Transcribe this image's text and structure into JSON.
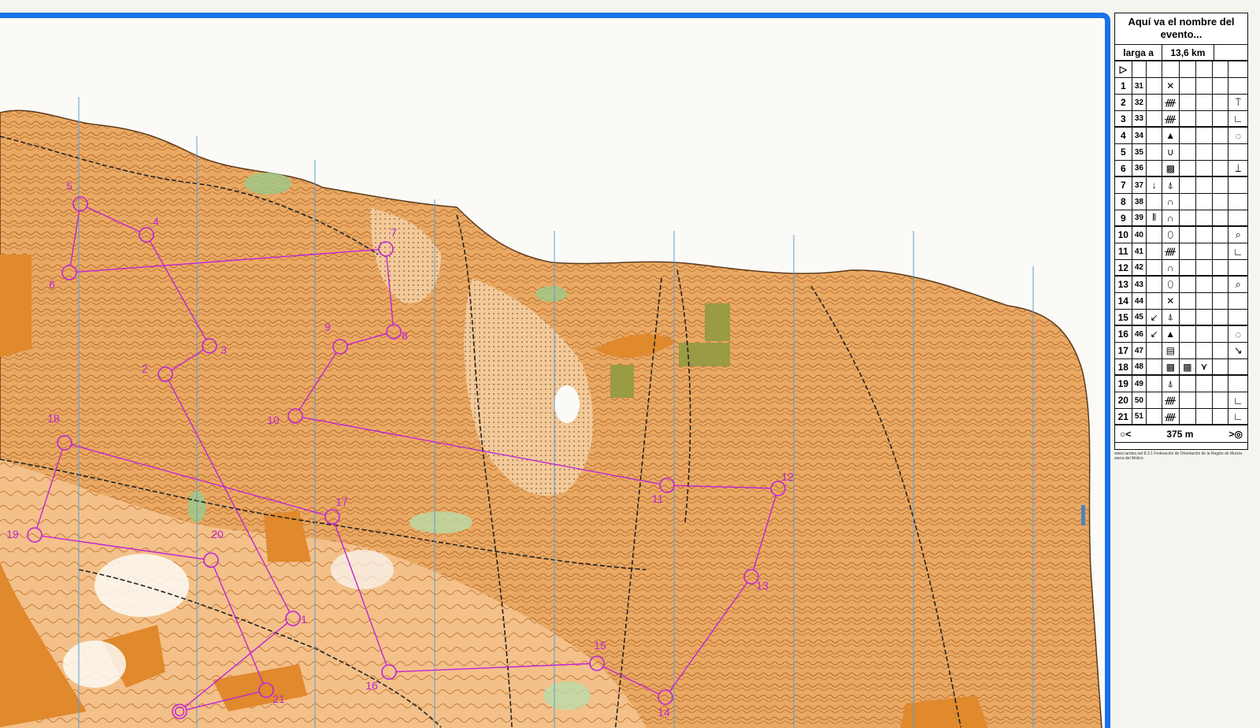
{
  "event": {
    "title_line1": "Aquí va el nombre del",
    "title_line2": "evento...",
    "course": "larga a",
    "length": "13,6 km",
    "start_symbol": "▷",
    "finish_left": "○<",
    "finish_distance": "375 m",
    "finish_right": ">◎"
  },
  "credit": {
    "line1": "www.candes.net 8.3.1 Federación de Orientación de la Región de Murcia",
    "line2": "sierra del Molino"
  },
  "controls": [
    {
      "n": "1",
      "code": "31",
      "c": "",
      "d": "✕",
      "e": "",
      "f": "",
      "g": "",
      "h": ""
    },
    {
      "n": "2",
      "code": "32",
      "c": "",
      "d": "ᚎ",
      "e": "",
      "f": "",
      "g": "",
      "h": "⍑"
    },
    {
      "n": "3",
      "code": "33",
      "c": "",
      "d": "ᚎ",
      "e": "",
      "f": "",
      "g": "",
      "h": "∟"
    },
    {
      "n": "4",
      "code": "34",
      "c": "",
      "d": "▲",
      "e": "",
      "f": "",
      "g": "",
      "h": "◌"
    },
    {
      "n": "5",
      "code": "35",
      "c": "",
      "d": "∪",
      "e": "",
      "f": "",
      "g": "",
      "h": ""
    },
    {
      "n": "6",
      "code": "36",
      "c": "",
      "d": "▩",
      "e": "",
      "f": "",
      "g": "",
      "h": "⟘"
    },
    {
      "n": "7",
      "code": "37",
      "c": "↓",
      "d": "⍋",
      "e": "",
      "f": "",
      "g": "",
      "h": ""
    },
    {
      "n": "8",
      "code": "38",
      "c": "",
      "d": "∩",
      "e": "",
      "f": "",
      "g": "",
      "h": ""
    },
    {
      "n": "9",
      "code": "39",
      "c": "⫴",
      "d": "∩",
      "e": "",
      "f": "",
      "g": "",
      "h": ""
    },
    {
      "n": "10",
      "code": "40",
      "c": "",
      "d": "⬯",
      "e": "",
      "f": "",
      "g": "",
      "h": "⌕"
    },
    {
      "n": "11",
      "code": "41",
      "c": "",
      "d": "ᚎ",
      "e": "",
      "f": "",
      "g": "",
      "h": "∟"
    },
    {
      "n": "12",
      "code": "42",
      "c": "",
      "d": "∩",
      "e": "",
      "f": "",
      "g": "",
      "h": ""
    },
    {
      "n": "13",
      "code": "43",
      "c": "",
      "d": "⬯",
      "e": "",
      "f": "",
      "g": "",
      "h": "⌕"
    },
    {
      "n": "14",
      "code": "44",
      "c": "",
      "d": "✕",
      "e": "",
      "f": "",
      "g": "",
      "h": ""
    },
    {
      "n": "15",
      "code": "45",
      "c": "↙",
      "d": "⍋",
      "e": "",
      "f": "",
      "g": "",
      "h": ""
    },
    {
      "n": "16",
      "code": "46",
      "c": "↙",
      "d": "▲",
      "e": "",
      "f": "",
      "g": "",
      "h": "◌"
    },
    {
      "n": "17",
      "code": "47",
      "c": "",
      "d": "▤",
      "e": "",
      "f": "",
      "g": "",
      "h": "↘"
    },
    {
      "n": "18",
      "code": "48",
      "c": "",
      "d": "▩",
      "e": "▩",
      "f": "⋎",
      "g": "",
      "h": ""
    },
    {
      "n": "19",
      "code": "49",
      "c": "",
      "d": "⍋",
      "e": "",
      "f": "",
      "g": "",
      "h": ""
    },
    {
      "n": "20",
      "code": "50",
      "c": "",
      "d": "ᚎ",
      "e": "",
      "f": "",
      "g": "",
      "h": "∟"
    },
    {
      "n": "21",
      "code": "51",
      "c": "",
      "d": "ᚎ",
      "e": "",
      "f": "",
      "g": "",
      "h": "∟"
    }
  ],
  "map_controls": [
    "1",
    "2",
    "3",
    "4",
    "5",
    "6",
    "7",
    "8",
    "9",
    "10",
    "11",
    "12",
    "13",
    "14",
    "15",
    "16",
    "17",
    "18",
    "19",
    "20",
    "21"
  ],
  "colors": {
    "frame": "#1a73e8",
    "course": "#c026d3",
    "terrain_orange": "#e8a25c",
    "terrain_light": "#f5d3a8",
    "vegetation": "#9cc98a",
    "contour": "#b5651d"
  }
}
